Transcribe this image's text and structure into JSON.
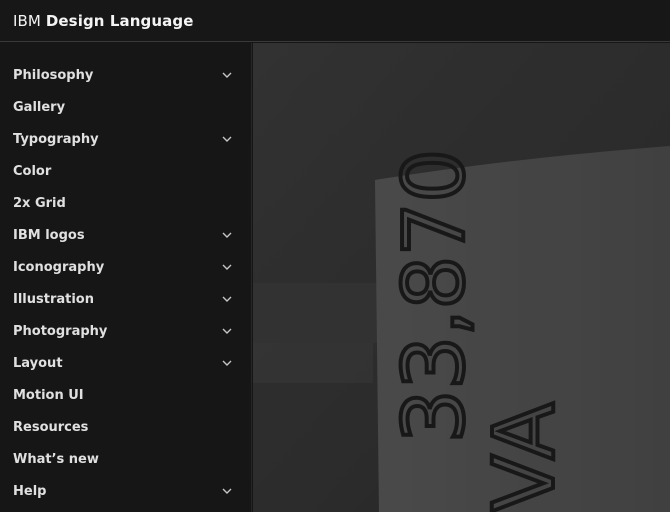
{
  "header": {
    "brand_plain": "IBM",
    "brand_bold": "Design Language"
  },
  "sidebar": {
    "items": [
      {
        "label": "Philosophy",
        "expandable": true
      },
      {
        "label": "Gallery",
        "expandable": false
      },
      {
        "label": "Typography",
        "expandable": true
      },
      {
        "label": "Color",
        "expandable": false
      },
      {
        "label": "2x Grid",
        "expandable": false
      },
      {
        "label": "IBM logos",
        "expandable": true
      },
      {
        "label": "Iconography",
        "expandable": true
      },
      {
        "label": "Illustration",
        "expandable": true
      },
      {
        "label": "Photography",
        "expandable": true
      },
      {
        "label": "Layout",
        "expandable": true
      },
      {
        "label": "Motion UI",
        "expandable": false
      },
      {
        "label": "Resources",
        "expandable": false
      },
      {
        "label": "What’s new",
        "expandable": false
      },
      {
        "label": "Help",
        "expandable": true
      }
    ]
  },
  "hero": {
    "photo_text_main": "33,870",
    "photo_text_side": "VA"
  },
  "colors": {
    "background": "#161616",
    "text": "#e0e0e0",
    "border": "#393939"
  },
  "icons": {
    "expand": "chevron-down-icon"
  }
}
